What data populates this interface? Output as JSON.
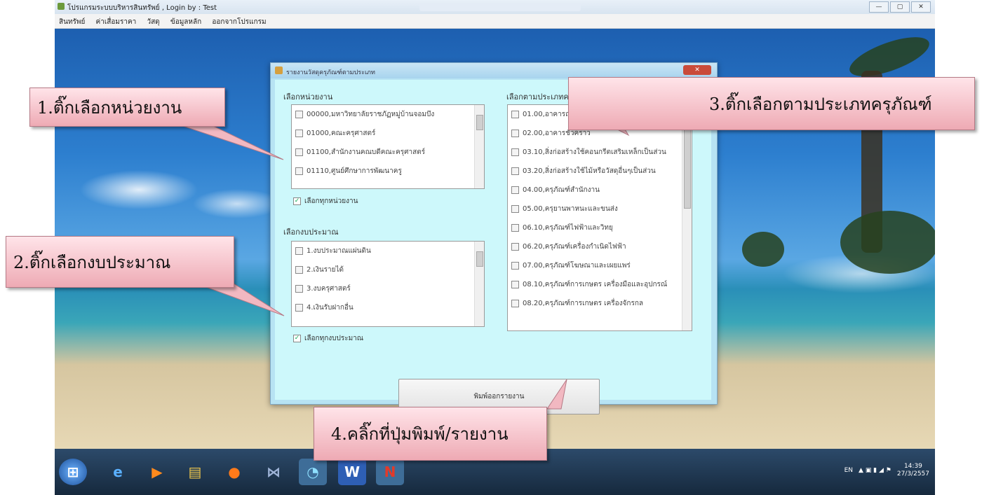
{
  "window": {
    "title": "โปรแกรมระบบบริหารสินทรัพย์ , Login by : Test",
    "controls": [
      "—",
      "▢",
      "✕"
    ]
  },
  "menu": [
    "สินทรัพย์",
    "ค่าเสื่อมราคา",
    "วัสดุ",
    "ข้อมูลหลัก",
    "ออกจากโปรแกรม"
  ],
  "dialog": {
    "title": "รายงานวัสดุครุภัณฑ์ตามประเภท",
    "close": "✕",
    "units": {
      "label": "เลือกหน่วยงาน",
      "items": [
        "00000,มหาวิทยาลัยราชภัฏหมู่บ้านจอมบึง",
        "01000,คณะครุศาสตร์",
        "01100,สำนักงานคณบดีคณะครุศาสตร์",
        "01110,ศูนย์ศึกษาการพัฒนาครู"
      ],
      "check_all": "เลือกทุกหน่วยงาน"
    },
    "budget": {
      "label": "เลือกงบประมาณ",
      "items": [
        "1.งบประมาณแผ่นดิน",
        "2.เงินรายได้",
        "3.งบครุศาสตร์",
        "4.เงินรับฝากอื่น"
      ],
      "check_all": "เลือกทุกงบประมาณ"
    },
    "types": {
      "label": "เลือกตามประเภทครุภัณฑ์",
      "items": [
        "01.00,อาคารถาวร",
        "02.00,อาคารชั่วคราว",
        "03.10,สิ่งก่อสร้างใช้คอนกรีตเสริมเหล็กเป็นส่วน",
        "03.20,สิ่งก่อสร้างใช้ไม้หรือวัสดุอื่นๆเป็นส่วน",
        "04.00,ครุภัณฑ์สำนักงาน",
        "05.00,ครุยานพาหนะและขนส่ง",
        "06.10,ครุภัณฑ์ไฟฟ้าและวิทยุ",
        "06.20,ครุภัณฑ์เครื่องกำเนิดไฟฟ้า",
        "07.00,ครุภัณฑ์โฆษณาและเผยแพร่",
        "08.10,ครุภัณฑ์การเกษตร เครื่องมือและอุปกรณ์",
        "08.20,ครุภัณฑ์การเกษตร เครื่องจักรกล"
      ]
    },
    "print_button": "พิมพ์ออกรายงาน"
  },
  "callouts": {
    "c1": "1.ติ๊กเลือกหน่วยงาน",
    "c2": "2.ติ๊กเลือกงบประมาณ",
    "c3": "3.ติ๊กเลือกตามประเภทครุภัณฑ์",
    "c4": "4.คลิ๊กที่ปุ่มพิมพ์/รายงาน"
  },
  "taskbar": {
    "items": [
      {
        "name": "start",
        "icon": "start-orb-icon"
      },
      {
        "name": "ie",
        "icon": "internet-explorer-icon"
      },
      {
        "name": "media",
        "icon": "media-player-icon"
      },
      {
        "name": "explorer",
        "icon": "folder-icon"
      },
      {
        "name": "firefox",
        "icon": "firefox-icon"
      },
      {
        "name": "app",
        "icon": "bowtie-app-icon"
      },
      {
        "name": "messenger",
        "icon": "messenger-icon"
      },
      {
        "name": "word",
        "icon": "word-icon"
      },
      {
        "name": "n-app",
        "icon": "n-app-icon"
      }
    ],
    "lang": "EN",
    "time": "14:39",
    "date": "27/3/2557"
  }
}
